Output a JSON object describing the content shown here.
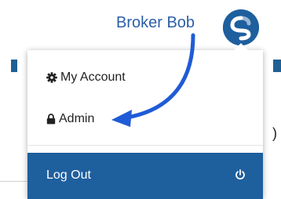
{
  "annotation": {
    "user_name": "Broker Bob"
  },
  "menu": {
    "items": [
      {
        "label": "My Account",
        "icon": "gear-icon"
      },
      {
        "label": "Admin",
        "icon": "lock-icon"
      }
    ],
    "logout": {
      "label": "Log Out",
      "icon": "power-icon"
    }
  },
  "colors": {
    "brand_blue": "#1e5f9e",
    "annotation_blue": "#2d5fa8",
    "text": "#222222"
  }
}
